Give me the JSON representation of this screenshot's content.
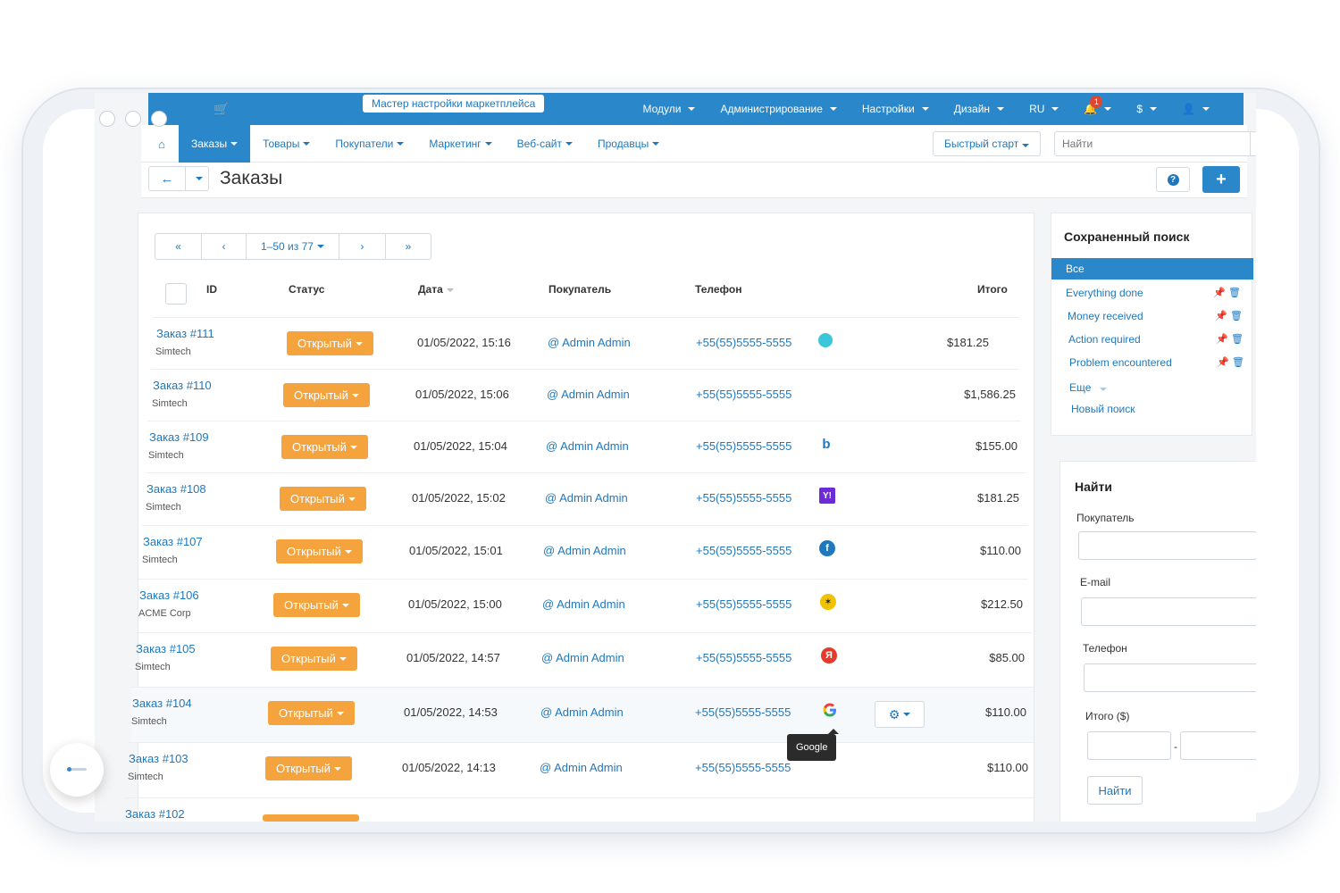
{
  "topbar": {
    "wizard_label": "Мастер настройки маркетплейса",
    "menu": [
      "Модули",
      "Администрирование",
      "Настройки",
      "Дизайн",
      "RU",
      "$"
    ],
    "notifications_count": "1"
  },
  "nav": {
    "tabs": [
      "Заказы",
      "Товары",
      "Покупатели",
      "Маркетинг",
      "Веб-сайт",
      "Продавцы"
    ],
    "active_tab": "Заказы",
    "quick_start": "Быстрый старт",
    "search_placeholder": "Найти"
  },
  "page": {
    "title": "Заказы"
  },
  "pager": {
    "first": "«",
    "prev": "‹",
    "range": "1–50 из 77",
    "next": "›",
    "last": "»"
  },
  "table": {
    "headers": {
      "id": "ID",
      "status": "Статус",
      "date": "Дата",
      "customer": "Покупатель",
      "phone": "Телефон",
      "total": "Итого"
    },
    "rows": [
      {
        "order": "Заказ #111",
        "company": "Simtech",
        "status": "Открытый",
        "date": "01/05/2022, 15:16",
        "customer": "@ Admin Admin",
        "phone": "+55(55)5555-5555",
        "source": "circle-icon",
        "total": "$181.25"
      },
      {
        "order": "Заказ #110",
        "company": "Simtech",
        "status": "Открытый",
        "date": "01/05/2022, 15:06",
        "customer": "@ Admin Admin",
        "phone": "+55(55)5555-5555",
        "source": "",
        "total": "$1,586.25"
      },
      {
        "order": "Заказ #109",
        "company": "Simtech",
        "status": "Открытый",
        "date": "01/05/2022, 15:04",
        "customer": "@ Admin Admin",
        "phone": "+55(55)5555-5555",
        "source": "bing-icon",
        "total": "$155.00"
      },
      {
        "order": "Заказ #108",
        "company": "Simtech",
        "status": "Открытый",
        "date": "01/05/2022, 15:02",
        "customer": "@ Admin Admin",
        "phone": "+55(55)5555-5555",
        "source": "yahoo-icon",
        "total": "$181.25"
      },
      {
        "order": "Заказ #107",
        "company": "Simtech",
        "status": "Открытый",
        "date": "01/05/2022, 15:01",
        "customer": "@ Admin Admin",
        "phone": "+55(55)5555-5555",
        "source": "facebook-icon",
        "total": "$110.00"
      },
      {
        "order": "Заказ #106",
        "company": "ACME Corp",
        "status": "Открытый",
        "date": "01/05/2022, 15:00",
        "customer": "@ Admin Admin",
        "phone": "+55(55)5555-5555",
        "source": "chicken-icon",
        "total": "$212.50"
      },
      {
        "order": "Заказ #105",
        "company": "Simtech",
        "status": "Открытый",
        "date": "01/05/2022, 14:57",
        "customer": "@ Admin Admin",
        "phone": "+55(55)5555-5555",
        "source": "yandex-icon",
        "total": "$85.00"
      },
      {
        "order": "Заказ #104",
        "company": "Simtech",
        "status": "Открытый",
        "date": "01/05/2022, 14:53",
        "customer": "@ Admin Admin",
        "phone": "+55(55)5555-5555",
        "source": "google-icon",
        "total": "$110.00"
      },
      {
        "order": "Заказ #103",
        "company": "Simtech",
        "status": "Открытый",
        "date": "01/05/2022, 14:13",
        "customer": "@ Admin Admin",
        "phone": "+55(55)5555-5555",
        "source": "",
        "total": "$110.00"
      },
      {
        "order": "Заказ #102",
        "company": "",
        "status": "",
        "date": "",
        "customer": "",
        "phone": "",
        "source": "",
        "total": ""
      }
    ],
    "tooltip": "Google"
  },
  "saved_search": {
    "title": "Сохраненный поиск",
    "all": "Все",
    "items": [
      "Everything done",
      "Money received",
      "Action required",
      "Problem encountered"
    ],
    "more": "Еще",
    "new": "Новый поиск"
  },
  "find": {
    "title": "Найти",
    "customer_label": "Покупатель",
    "email_label": "E-mail",
    "phone_label": "Телефон",
    "total_label": "Итого ($)",
    "range_sep": "-",
    "button": "Найти"
  },
  "colors": {
    "primary": "#2a87c9",
    "link": "#1f78bd",
    "status": "#f5a33d"
  }
}
